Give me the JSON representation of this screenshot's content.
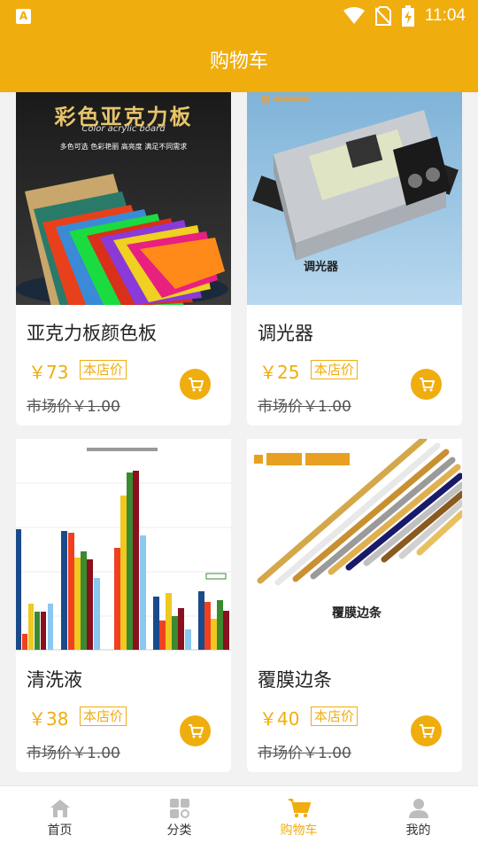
{
  "status_bar": {
    "time": "11:04"
  },
  "header": {
    "title": "购物车"
  },
  "products": [
    {
      "name": "亚克力板颜色板",
      "price": "￥73",
      "badge": "本店价",
      "market_price": "市场价￥1.00",
      "image_text": {
        "title": "彩色亚克力板",
        "subtitle": "Color acrylic board",
        "tagline": "多色可选  色彩艳丽  高亮度  满足不同需求"
      }
    },
    {
      "name": "调光器",
      "price": "￥25",
      "badge": "本店价",
      "market_price": "市场价￥1.00",
      "image_text": {
        "caption": "调光器"
      }
    },
    {
      "name": "清洗液",
      "price": "￥38",
      "badge": "本店价",
      "market_price": "市场价￥1.00",
      "image_text": {}
    },
    {
      "name": "覆膜边条",
      "price": "￥40",
      "badge": "本店价",
      "market_price": "市场价￥1.00",
      "image_text": {
        "caption": "覆膜边条"
      }
    }
  ],
  "tabs": [
    {
      "label": "首页",
      "icon": "home-icon",
      "active": false
    },
    {
      "label": "分类",
      "icon": "category-icon",
      "active": false
    },
    {
      "label": "购物车",
      "icon": "cart-icon",
      "active": true
    },
    {
      "label": "我的",
      "icon": "user-icon",
      "active": false
    }
  ],
  "colors": {
    "accent": "#f0ad0e",
    "background": "#f2f2f2"
  }
}
